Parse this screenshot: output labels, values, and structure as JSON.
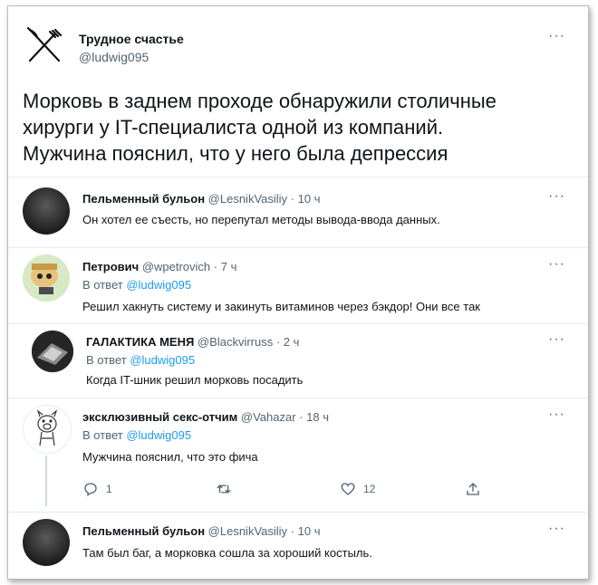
{
  "main_tweet": {
    "author_name": "Трудное счастье",
    "handle": "@ludwig095",
    "text_lines": [
      "Морковь в заднем проходе обнаружили столичные",
      "хирурги у IT-специалиста одной из компаний.",
      "Мужчина пояснил, что у него была депрессия"
    ],
    "more": "···"
  },
  "replies": [
    {
      "name": "Пельменный бульон",
      "handle": "@LesnikVasiliy",
      "time": "· 10 ч",
      "reply_to": "",
      "text": "Он хотел ее съесть, но перепутал методы вывода-ввода данных.",
      "more": "···"
    },
    {
      "name": "Петрович",
      "handle": "@wpetrovich",
      "time": "· 7 ч",
      "reply_prefix": "В ответ",
      "reply_to": "@ludwig095",
      "text": "Решил хакнуть систему и закинуть витаминов через бэкдор! Они все так",
      "more": "···"
    },
    {
      "name": "ГАЛАКТИКА МЕНЯ",
      "handle": "@Blackvirruss",
      "time": "· 2 ч",
      "reply_prefix": "В ответ",
      "reply_to": "@ludwig095",
      "text": "Когда IT-шник решил морковь посадить",
      "more": "···"
    },
    {
      "name": "эксклюзивный секс-отчим",
      "handle": "@Vahazar",
      "time": "· 18 ч",
      "reply_prefix": "В ответ",
      "reply_to": "@ludwig095",
      "text": "Мужчина пояснил, что это фича",
      "more": "···",
      "actions": {
        "replies": "1",
        "retweets": "",
        "likes": "12"
      }
    },
    {
      "name": "Пельменный бульон",
      "handle": "@LesnikVasiliy",
      "time": "· 10 ч",
      "reply_to": "",
      "text": "Там был баг, а морковка сошла за хороший костыль.",
      "more": "···"
    }
  ],
  "icons": {
    "main_avatar": "crossed-fork-knife-icon",
    "reply": "speech-bubble-icon",
    "retweet": "retweet-icon",
    "like": "heart-icon",
    "share": "share-icon"
  },
  "colors": {
    "link": "#1d9bf0",
    "muted": "#536471",
    "text": "#0f1419"
  }
}
